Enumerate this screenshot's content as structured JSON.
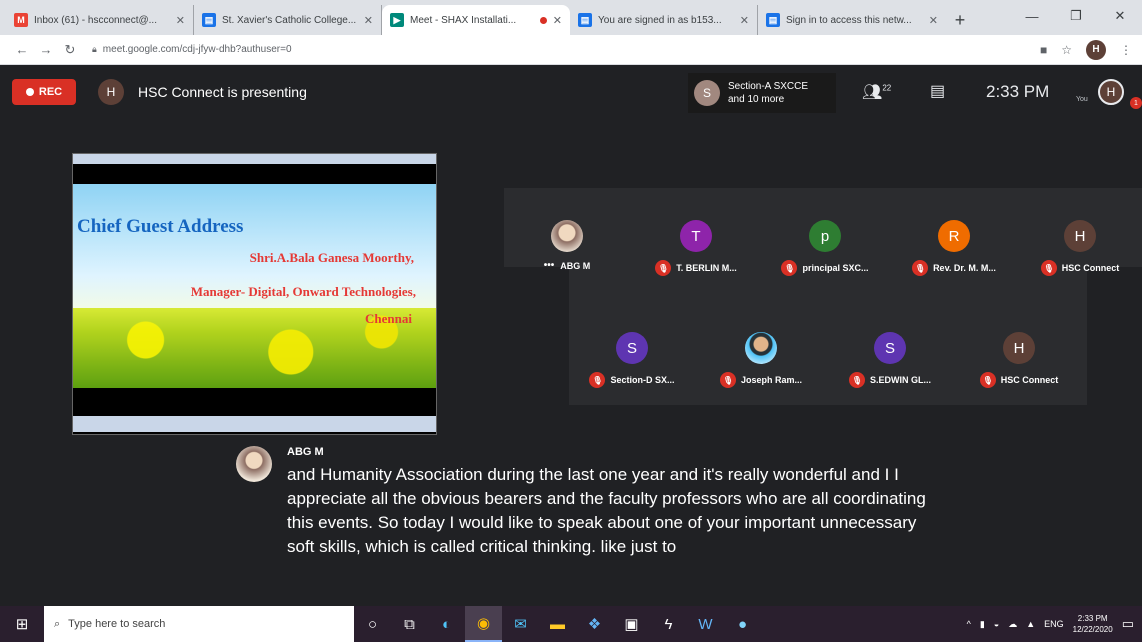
{
  "browser": {
    "tabs": [
      {
        "title": "Inbox (61) - hscconnect@...",
        "icon_color": "#ea4335",
        "icon": "gmail-icon",
        "active": false
      },
      {
        "title": "St. Xavier's Catholic College...",
        "icon_color": "#1a73e8",
        "icon": "document-icon",
        "active": false
      },
      {
        "title": "Meet - SHAX Installati...",
        "icon_color": "#00897b",
        "icon": "meet-icon",
        "active": true,
        "recording": true
      },
      {
        "title": "You are signed in as b153...",
        "icon_color": "#1a73e8",
        "icon": "document-icon",
        "active": false
      },
      {
        "title": "Sign in to access this netw...",
        "icon_color": "#1a73e8",
        "icon": "document-icon",
        "active": false
      }
    ],
    "url": "meet.google.com/cdj-jfyw-dhb?authuser=0"
  },
  "meet": {
    "rec_label": "REC",
    "presenter_initial": "H",
    "presenting_text": "HSC Connect is presenting",
    "section_chip": {
      "initial": "S",
      "line1": "Section-A SXCCE",
      "line2": "and 10 more"
    },
    "people_count": "22",
    "time": "2:33 PM",
    "you_label": "You",
    "self_initial": "H",
    "notification_count": "1"
  },
  "slide": {
    "title": "Chief Guest Address",
    "line1": "Shri.A.Bala Ganesa Moorthy,",
    "line2": "Manager- Digital, Onward Technologies,",
    "line3": "Chennai"
  },
  "participants_row1": [
    {
      "name": "ABG M",
      "initial": "",
      "color": "",
      "photo": true,
      "more": "•••",
      "muted": false
    },
    {
      "name": "T. BERLIN M...",
      "initial": "T",
      "color": "#8e24aa",
      "muted": true
    },
    {
      "name": "principal SXC...",
      "initial": "p",
      "color": "#2e7d32",
      "muted": true
    },
    {
      "name": "Rev. Dr. M. M...",
      "initial": "R",
      "color": "#ef6c00",
      "muted": true
    },
    {
      "name": "HSC Connect",
      "initial": "H",
      "color": "#5d4037",
      "muted": true
    }
  ],
  "participants_row2": [
    {
      "name": "Section-D SX...",
      "initial": "S",
      "color": "#5e35b1",
      "muted": true
    },
    {
      "name": "Joseph Ram...",
      "initial": "",
      "color": "",
      "photo2": true,
      "muted": true
    },
    {
      "name": "S.EDWIN GL...",
      "initial": "S",
      "color": "#5e35b1",
      "muted": true
    },
    {
      "name": "HSC Connect",
      "initial": "H",
      "color": "#5d4037",
      "muted": true
    }
  ],
  "caption": {
    "speaker": "ABG M",
    "text": "and Humanity Association during the last one year and it's really wonderful and I I appreciate all the obvious bearers and the faculty professors who are all coordinating this events. So today I would like to speak about one of your important unnecessary soft skills, which is called critical thinking. like just to"
  },
  "taskbar": {
    "search_placeholder": "Type here to search",
    "lang": "ENG",
    "time": "2:33 PM",
    "date": "12/22/2020"
  }
}
